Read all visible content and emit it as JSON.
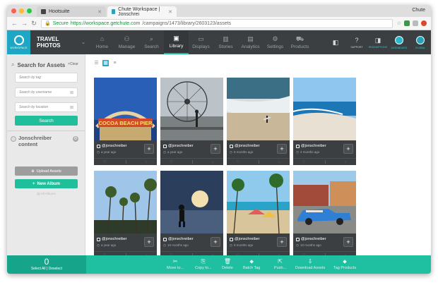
{
  "browser": {
    "tabs": [
      {
        "label": "Hootsuite",
        "active": false
      },
      {
        "label": "Chute Workspace | Jonschrei",
        "active": true
      }
    ],
    "profile": "Chute",
    "secure_label": "Secure",
    "url_host": "https://workspace.getchute.com",
    "url_path": "/campaigns/1473/library/2603123/assets"
  },
  "app": {
    "logo_label": "WORKSPACE",
    "brand": "TRAVEL PHOTOS",
    "nav": [
      {
        "label": "Home",
        "icon": "home-icon",
        "glyph": "⌂",
        "active": false
      },
      {
        "label": "Manage",
        "icon": "manage-icon",
        "glyph": "⚇",
        "active": false
      },
      {
        "label": "Search",
        "icon": "search-icon",
        "glyph": "⌕",
        "active": false
      },
      {
        "label": "Library",
        "icon": "library-icon",
        "glyph": "▣",
        "active": true
      },
      {
        "label": "Displays",
        "icon": "displays-icon",
        "glyph": "▭",
        "active": false
      },
      {
        "label": "Stories",
        "icon": "stories-icon",
        "glyph": "▥",
        "active": false
      },
      {
        "label": "Analytics",
        "icon": "analytics-icon",
        "glyph": "▤",
        "active": false
      },
      {
        "label": "Settings",
        "icon": "settings-icon",
        "glyph": "⚙",
        "active": false
      },
      {
        "label": "Products",
        "icon": "products-icon",
        "glyph": "⛟",
        "active": false
      }
    ],
    "right_nav": [
      {
        "label": "",
        "icon": "panel-icon",
        "glyph": "◧"
      },
      {
        "label": "SUPPORT",
        "icon": "support-icon",
        "glyph": "?"
      },
      {
        "label": "REDEMPTIONS",
        "icon": "redemptions-icon",
        "glyph": "◨"
      },
      {
        "label": "DASHBOARD",
        "icon": "dashboard-icon",
        "glyph": ""
      },
      {
        "label": "GLOBAL",
        "icon": "global-icon",
        "glyph": ""
      }
    ]
  },
  "sidebar": {
    "title": "Search for Assets",
    "clear_label": "×Clear",
    "inputs": [
      {
        "placeholder": "Search by tag",
        "clearable": false
      },
      {
        "placeholder": "Search by username",
        "clearable": true
      },
      {
        "placeholder": "Search by location",
        "clearable": true
      }
    ],
    "search_button": "Search",
    "owner_name": "Jonschreiber content",
    "upload_button": "Upload Assets",
    "new_album_button": "New Album",
    "all_albums": "All Albums"
  },
  "grid": {
    "assets": [
      {
        "user": "@jonschreiber",
        "age": "a year ago",
        "scene": "cocoa-beach-pier"
      },
      {
        "user": "@jonschreiber",
        "age": "a year ago",
        "scene": "ferris-wheel"
      },
      {
        "user": "@jonschreiber",
        "age": "5 months ago",
        "scene": "surfer-beach"
      },
      {
        "user": "@jonschreiber",
        "age": "4 months ago",
        "scene": "tropical-shore"
      },
      {
        "user": "@jonschreiber",
        "age": "a year ago",
        "scene": "palm-trees"
      },
      {
        "user": "@jonschreiber",
        "age": "10 months ago",
        "scene": "child-sunset"
      },
      {
        "user": "@jonschreiber",
        "age": "9 months ago",
        "scene": "beach-umbrellas"
      },
      {
        "user": "@jonschreiber",
        "age": "10 months ago",
        "scene": "blue-classic-car"
      }
    ]
  },
  "bottom": {
    "selected_count": "0",
    "select_label": "Select All | Deselect",
    "actions": [
      {
        "label": "Move to...",
        "icon": "move-icon",
        "glyph": "✂"
      },
      {
        "label": "Copy to...",
        "icon": "copy-icon",
        "glyph": "⎘"
      },
      {
        "label": "Delete",
        "icon": "delete-icon",
        "glyph": "🗑"
      },
      {
        "label": "Batch Tag",
        "icon": "tag-icon",
        "glyph": "⬥"
      },
      {
        "label": "Push...",
        "icon": "push-icon",
        "glyph": "⇱"
      },
      {
        "label": "Download Assets",
        "icon": "download-icon",
        "glyph": "⇩"
      },
      {
        "label": "Tag Products",
        "icon": "tag-products-icon",
        "glyph": "⬥"
      }
    ]
  },
  "colors": {
    "accent": "#1fbfa2",
    "nav_bg": "#3b3f42",
    "brand_blue": "#1ea7c4"
  }
}
